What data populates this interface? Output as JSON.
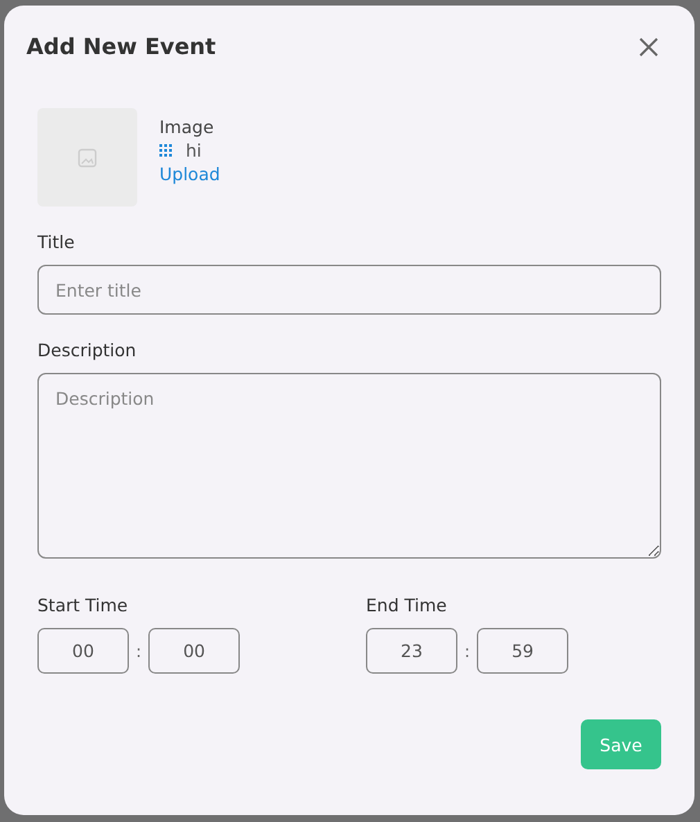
{
  "dialog": {
    "title": "Add New Event"
  },
  "image": {
    "label": "Image",
    "file_name": "hi",
    "upload_link": "Upload"
  },
  "title_field": {
    "label": "Title",
    "placeholder": "Enter title"
  },
  "description_field": {
    "label": "Description",
    "placeholder": "Description"
  },
  "start_time": {
    "label": "Start Time",
    "hours": "00",
    "separator": ":",
    "minutes": "00"
  },
  "end_time": {
    "label": "End Time",
    "hours": "23",
    "separator": ":",
    "minutes": "59"
  },
  "buttons": [
    {
      "label": "Save"
    }
  ]
}
